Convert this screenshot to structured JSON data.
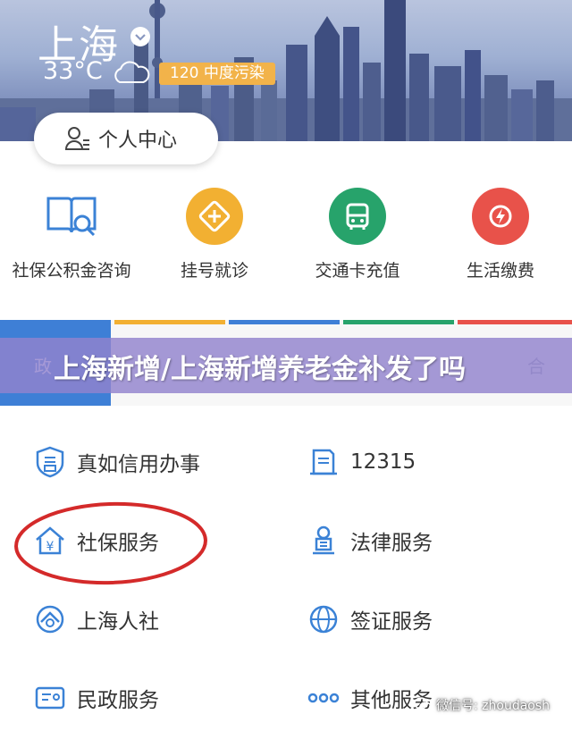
{
  "header": {
    "city": "上海",
    "temperature": "33°C",
    "air_quality": "120 中度污染"
  },
  "personal_center": {
    "label": "个人中心"
  },
  "quick_services": [
    {
      "label": "社保公积金咨询",
      "icon": "book-search-icon",
      "color": "#3b82d6"
    },
    {
      "label": "挂号就诊",
      "icon": "medical-cross-icon",
      "color": "#f2b032"
    },
    {
      "label": "交通卡充值",
      "icon": "bus-icon",
      "color": "#27a36b"
    },
    {
      "label": "生活缴费",
      "icon": "lightning-icon",
      "color": "#e8524a"
    }
  ],
  "tabs": {
    "left_label": "政",
    "right_label": "合",
    "line_colors": [
      "#3e7fd6",
      "#f2b032",
      "#3e7fd6",
      "#27a36b",
      "#e8524a"
    ]
  },
  "overlay": {
    "title": "上海新增/上海新增养老金补发了吗"
  },
  "services": [
    {
      "label": "真如信用办事",
      "icon": "credit-badge-icon"
    },
    {
      "label": "12315",
      "icon": "document-icon"
    },
    {
      "label": "社保服务",
      "icon": "yuan-house-icon"
    },
    {
      "label": "法律服务",
      "icon": "justice-icon"
    },
    {
      "label": "上海人社",
      "icon": "shield-people-icon"
    },
    {
      "label": "签证服务",
      "icon": "globe-icon"
    },
    {
      "label": "民政服务",
      "icon": "id-card-icon"
    },
    {
      "label": "其他服务",
      "icon": "more-dots-icon"
    }
  ],
  "watermark": {
    "text": "微信号: zhoudaosh"
  },
  "colors": {
    "accent_blue": "#3e7fd6",
    "icon_blue": "#3b82d6",
    "highlight_red": "#d42a2a"
  }
}
